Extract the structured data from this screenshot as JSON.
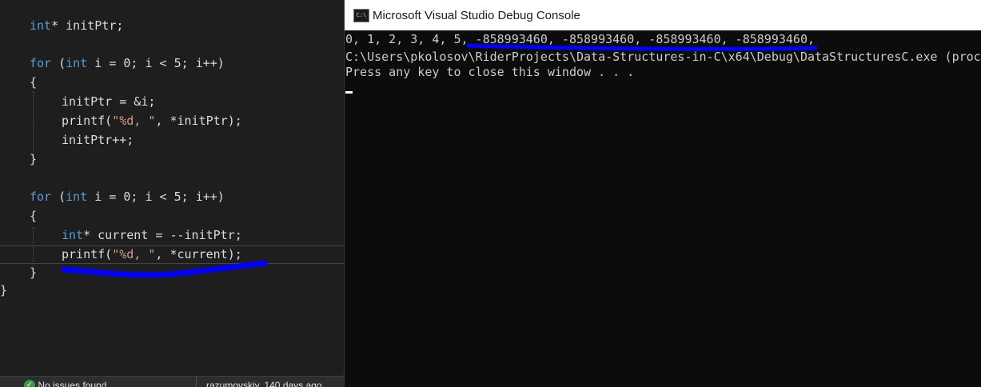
{
  "editor": {
    "code": [
      {
        "type": "plain",
        "text": "int* initPtr;"
      },
      {
        "type": "plain",
        "text": "for (int i = 0; i < 5; i++)"
      },
      {
        "type": "plain",
        "text": "{"
      },
      {
        "type": "plain",
        "text": "initPtr = &i;"
      },
      {
        "type": "plain",
        "text": "printf(\"%d, \", *initPtr);"
      },
      {
        "type": "plain",
        "text": "initPtr++;"
      },
      {
        "type": "plain",
        "text": "}"
      },
      {
        "type": "plain",
        "text": "for (int i = 0; i < 5; i++)"
      },
      {
        "type": "plain",
        "text": "{"
      },
      {
        "type": "plain",
        "text": "int* current = --initPtr;"
      },
      {
        "type": "plain",
        "text": "printf(\"%d, \", *current);"
      },
      {
        "type": "plain",
        "text": "}"
      },
      {
        "type": "plain",
        "text": "}"
      }
    ],
    "status": {
      "issues": "No issues found",
      "blame": "razumovskiy, 140 days ago"
    }
  },
  "console": {
    "title": "Microsoft Visual Studio Debug Console",
    "icon": "C:\\",
    "output": [
      "0, 1, 2, 3, 4, 5, -858993460, -858993460, -858993460, -858993460,",
      "C:\\Users\\pkolosov\\RiderProjects\\Data-Structures-in-C\\x64\\Debug\\DataStructuresC.exe (proce",
      "Press any key to close this window . . ."
    ]
  },
  "colors": {
    "keyword": "#569cd6",
    "string": "#d69d85",
    "annotation": "#0000ff"
  }
}
